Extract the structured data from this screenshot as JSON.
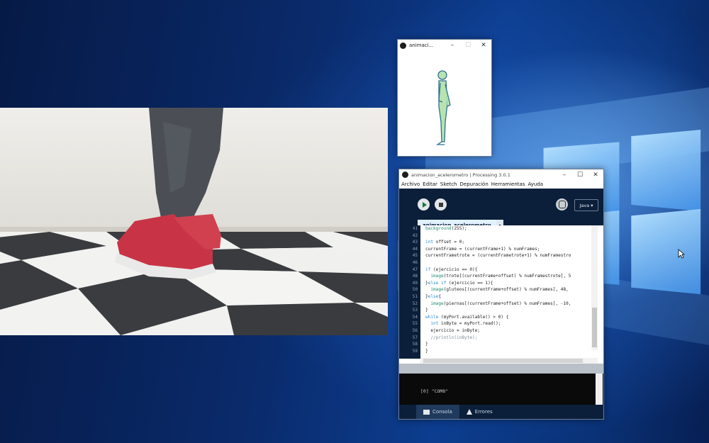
{
  "sketch_window": {
    "title": "animaci...",
    "controls": [
      "–",
      "☐",
      "✕"
    ]
  },
  "ide": {
    "title": "animacion_acelerometro | Processing 3.0.1",
    "controls": [
      "–",
      "☐",
      "✕"
    ],
    "menu": [
      "Archivo",
      "Editar",
      "Sketch",
      "Depuración",
      "Herramientas",
      "Ayuda"
    ],
    "mode": "Java ▾",
    "tab": "animacion_acelerometro",
    "tab_arrow": "▾",
    "code_lines": [
      {
        "n": "41",
        "text": "background(255);"
      },
      {
        "n": "42",
        "text": ""
      },
      {
        "n": "43",
        "text": "int offset = 0;"
      },
      {
        "n": "44",
        "text": "currentFrame = (currentFrame+1) % numFrames;"
      },
      {
        "n": "45",
        "text": "currentFrametrote = (currentFrametrote+1) % numFramestro"
      },
      {
        "n": "46",
        "text": ""
      },
      {
        "n": "47",
        "text": "if (ejercicio == 0){"
      },
      {
        "n": "48",
        "text": "  image(trote[(currentFrame+offset) % numFramestrote], 5"
      },
      {
        "n": "49",
        "text": "}else if (ejercicio == 1){"
      },
      {
        "n": "50",
        "text": "  image(gluteos[(currentFrame+offset) % numFrames], 48,"
      },
      {
        "n": "51",
        "text": "}else{"
      },
      {
        "n": "52",
        "text": "  image(piernas[(currentFrame+offset) % numFrames], -10,"
      },
      {
        "n": "53",
        "text": "}"
      },
      {
        "n": "54",
        "text": "while (myPort.available() > 0) {"
      },
      {
        "n": "55",
        "text": "  int inByte = myPort.read();"
      },
      {
        "n": "56",
        "text": "  ejercicio = inByte;"
      },
      {
        "n": "57",
        "text": "  //println(inByte);"
      },
      {
        "n": "58",
        "text": "}"
      },
      {
        "n": "59",
        "text": "}"
      }
    ],
    "console_text": "[0] \"COM8\"",
    "footer_tabs": {
      "console": "Consola",
      "errors": "Errores"
    }
  },
  "colors": {
    "ide_dark": "#0b1f3a",
    "tab_active": "#e2f1ff",
    "figure_fill": "#b6e3b0",
    "figure_stroke": "#2f6f8f"
  },
  "icons": [
    "play-icon",
    "stop-icon",
    "debug-icon",
    "processing-logo-icon",
    "console-icon",
    "warning-icon",
    "mouse-cursor-icon"
  ]
}
